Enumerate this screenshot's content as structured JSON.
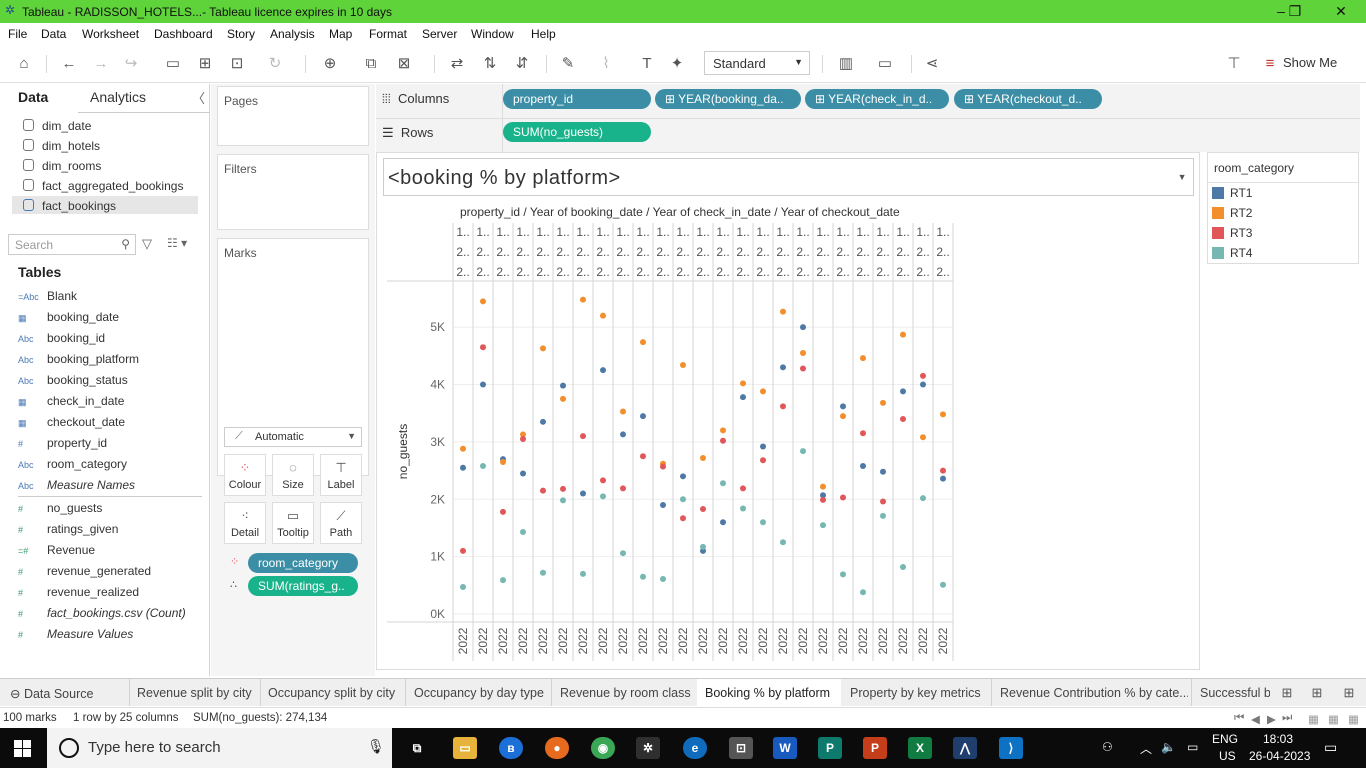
{
  "window": {
    "title": "Tableau - RADISSON_HOTELS...- Tableau licence expires in 10 days"
  },
  "menu": [
    "File",
    "Data",
    "Worksheet",
    "Dashboard",
    "Story",
    "Analysis",
    "Map",
    "Format",
    "Server",
    "Window",
    "Help"
  ],
  "toolbar": {
    "fit_mode": "Standard",
    "show_me": "Show Me"
  },
  "left_pane": {
    "tab_data": "Data",
    "tab_analytics": "Analytics",
    "datasources": [
      "dim_date",
      "dim_hotels",
      "dim_rooms",
      "fact_aggregated_bookings",
      "fact_bookings"
    ],
    "search_placeholder": "Search",
    "tables_heading": "Tables",
    "dimensions": [
      {
        "type": "=Abc",
        "name": "Blank"
      },
      {
        "type": "cal",
        "name": "booking_date"
      },
      {
        "type": "Abc",
        "name": "booking_id"
      },
      {
        "type": "Abc",
        "name": "booking_platform"
      },
      {
        "type": "Abc",
        "name": "booking_status"
      },
      {
        "type": "cal",
        "name": "check_in_date"
      },
      {
        "type": "cal",
        "name": "checkout_date"
      },
      {
        "type": "#",
        "name": "property_id"
      },
      {
        "type": "Abc",
        "name": "room_category"
      },
      {
        "type": "Abc",
        "name": "Measure Names"
      }
    ],
    "measures": [
      {
        "type": "#",
        "name": "no_guests"
      },
      {
        "type": "#",
        "name": "ratings_given"
      },
      {
        "type": "=#",
        "name": "Revenue"
      },
      {
        "type": "#",
        "name": "revenue_generated"
      },
      {
        "type": "#",
        "name": "revenue_realized"
      },
      {
        "type": "#",
        "name": "fact_bookings.csv (Count)"
      },
      {
        "type": "#",
        "name": "Measure Values"
      }
    ]
  },
  "cards": {
    "pages": "Pages",
    "filters": "Filters",
    "marks": "Marks",
    "mark_type": "Automatic",
    "mark_buttons": [
      "Colour",
      "Size",
      "Label",
      "Detail",
      "Tooltip",
      "Path"
    ],
    "mark_pills": [
      "room_category",
      "SUM(ratings_g.."
    ]
  },
  "shelves": {
    "columns_label": "Columns",
    "rows_label": "Rows",
    "columns": [
      "property_id",
      "YEAR(booking_da..",
      "YEAR(check_in_d..",
      "YEAR(checkout_d.."
    ],
    "rows": [
      "SUM(no_guests)"
    ]
  },
  "view": {
    "title": "<booking % by platform>",
    "header": "property_id  /  Year of booking_date  /  Year of check_in_date  /  Year of checkout_date",
    "header_cell1": "1..",
    "header_cell2": "2..",
    "year_label": "2022"
  },
  "legend": {
    "title": "room_category",
    "items": [
      {
        "label": "RT1",
        "color": "#4e79a7"
      },
      {
        "label": "RT2",
        "color": "#f28e2b"
      },
      {
        "label": "RT3",
        "color": "#e15759"
      },
      {
        "label": "RT4",
        "color": "#76b7b2"
      }
    ]
  },
  "chart_data": {
    "type": "scatter",
    "title": "<booking % by platform>",
    "ylabel": "no_guests",
    "ylim": [
      0,
      5700
    ],
    "yticks": [
      0,
      1000,
      2000,
      3000,
      4000,
      5000
    ],
    "ytick_labels": [
      "0K",
      "1K",
      "2K",
      "3K",
      "4K",
      "5K"
    ],
    "columns": 25,
    "x_tick_label": "2022",
    "series": [
      {
        "name": "RT1",
        "color": "#4e79a7",
        "values": [
          2550,
          4000,
          2700,
          2450,
          3350,
          3980,
          2100,
          4250,
          3130,
          3450,
          1900,
          2400,
          1100,
          1600,
          3780,
          2920,
          4300,
          5000,
          2070,
          3620,
          2580,
          2480,
          3880,
          4000,
          2360
        ]
      },
      {
        "name": "RT2",
        "color": "#f28e2b",
        "values": [
          2880,
          5450,
          2650,
          3130,
          4630,
          3750,
          5480,
          5200,
          3530,
          4740,
          2620,
          4340,
          2720,
          3200,
          4020,
          3880,
          5270,
          4550,
          2220,
          3450,
          4460,
          3680,
          4870,
          3080,
          3480
        ]
      },
      {
        "name": "RT3",
        "color": "#e15759",
        "values": [
          1100,
          4650,
          1780,
          3050,
          2150,
          2180,
          3100,
          2330,
          2190,
          2750,
          2570,
          1670,
          1830,
          3020,
          2190,
          2680,
          3620,
          4280,
          1990,
          2030,
          3150,
          1960,
          3400,
          4150,
          2500
        ]
      },
      {
        "name": "RT4",
        "color": "#76b7b2",
        "values": [
          470,
          2580,
          590,
          1430,
          720,
          1980,
          700,
          2050,
          1060,
          650,
          610,
          2000,
          1170,
          2280,
          1840,
          1600,
          1250,
          2840,
          1550,
          690,
          380,
          1710,
          820,
          2020,
          510
        ]
      }
    ]
  },
  "sheet_tabs": [
    "Data Source",
    "Revenue split by city",
    "Occupancy split by city",
    "Occupancy by day type",
    "Revenue by room class",
    "Booking % by platform",
    "Property by key metrics",
    "Revenue Contribution % by cate...",
    "Successful b"
  ],
  "status": {
    "marks": "100 marks",
    "layout": "1 row by 25 columns",
    "sum": "SUM(no_guests): 274,134"
  },
  "taskbar": {
    "search": "Type here to search",
    "lang1": "ENG",
    "lang2": "US",
    "time": "18:03",
    "date": "26-04-2023"
  }
}
